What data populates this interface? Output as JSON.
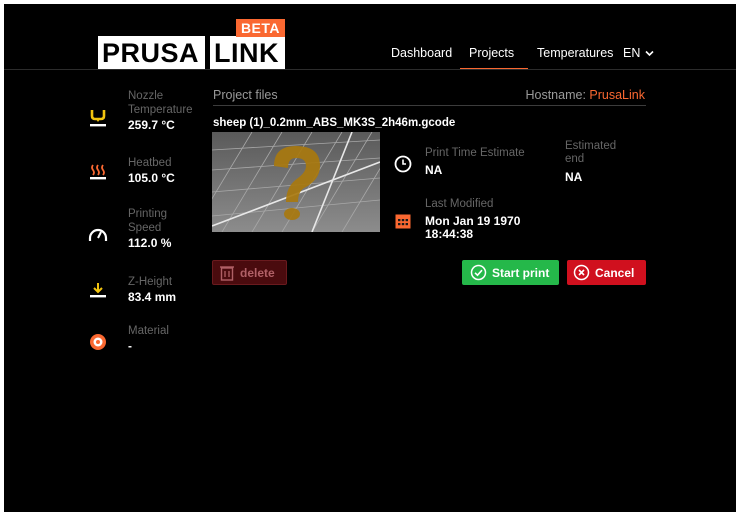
{
  "brand": {
    "logo_left": "PRUSA",
    "logo_right": "LINK",
    "badge": "BETA",
    "accent_color": "#fa6831"
  },
  "nav": {
    "dashboard": "Dashboard",
    "projects": "Projects",
    "temperatures": "Temperatures",
    "language": "EN",
    "active": "Projects"
  },
  "sidebar": {
    "nozzle": {
      "label_1": "Nozzle",
      "label_2": "Temperature",
      "value": "259.7 °C",
      "icon": "nozzle-icon"
    },
    "heatbed": {
      "label": "Heatbed",
      "value": "105.0 °C",
      "icon": "heatbed-icon"
    },
    "speed": {
      "label_1": "Printing",
      "label_2": "Speed",
      "value": "112.0 %",
      "icon": "speedometer-icon"
    },
    "zheight": {
      "label": "Z-Height",
      "value": "83.4 mm",
      "icon": "z-height-icon"
    },
    "material": {
      "label": "Material",
      "value": "-",
      "icon": "spool-icon"
    }
  },
  "main": {
    "section_title": "Project files",
    "hostname_label": "Hostname:",
    "hostname_value": "PrusaLink",
    "filename": "sheep (1)_0.2mm_ABS_MK3S_2h46m.gcode",
    "print_time_label": "Print Time Estimate",
    "print_time_value": "NA",
    "estimated_end_label_1": "Estimated",
    "estimated_end_label_2": "end",
    "estimated_end_value": "NA",
    "last_modified_label": "Last Modified",
    "last_modified_date": "Mon Jan 19 1970",
    "last_modified_time": "18:44:38"
  },
  "actions": {
    "delete": "delete",
    "start": "Start print",
    "cancel": "Cancel"
  },
  "colors": {
    "start": "#25b84a",
    "cancel": "#d0101e",
    "delete": "#4a0b0e",
    "icon_yellow": "#f2c40f",
    "icon_orange": "#fa6831"
  }
}
